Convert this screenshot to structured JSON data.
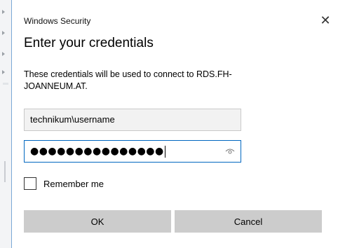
{
  "dialog": {
    "app_title": "Windows Security",
    "heading": "Enter your credentials",
    "message": "These credentials will be used to connect to RDS.FH-JOANNEUM.AT.",
    "close_symbol": "✕",
    "close_icon": "close-icon"
  },
  "username": {
    "value": "technikum\\username"
  },
  "password": {
    "masked_value": "●●●●●●●●●●●●●●●",
    "reveal_icon": "eye-icon"
  },
  "remember_me": {
    "label": "Remember me",
    "checked": false
  },
  "buttons": {
    "ok_label": "OK",
    "cancel_label": "Cancel"
  },
  "colors": {
    "focus_border": "#0067c0",
    "button_bg": "#cccccc",
    "field_bg": "#f2f2f2"
  }
}
